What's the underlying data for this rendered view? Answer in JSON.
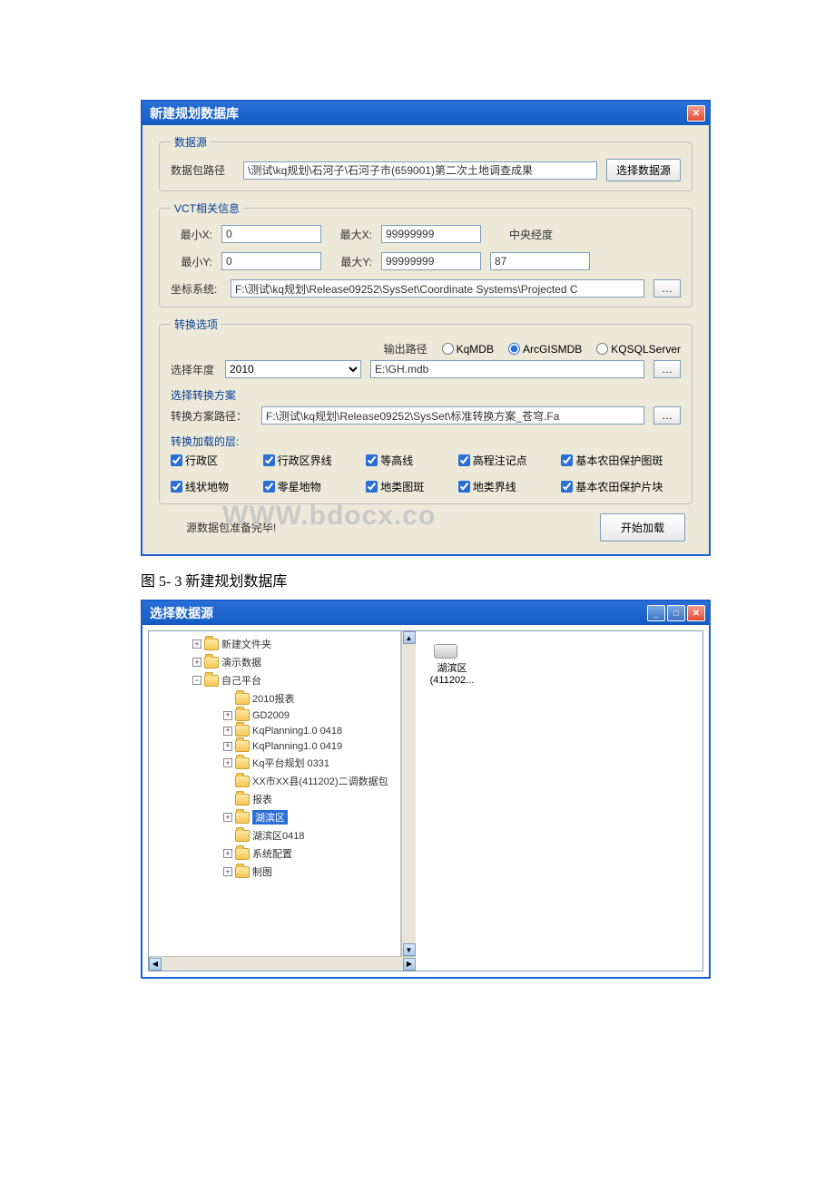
{
  "dialog1": {
    "title": "新建规划数据库",
    "source": {
      "legend": "数据源",
      "path_label": "数据包路径",
      "path_value": "\\测试\\kq规划\\石河子\\石河子市(659001)第二次土地调查成果",
      "select_btn": "选择数据源"
    },
    "vct": {
      "legend": "VCT相关信息",
      "minx_label": "最小X:",
      "minx": "0",
      "maxx_label": "最大X:",
      "maxx": "99999999",
      "central_label": "中央经度",
      "miny_label": "最小Y:",
      "miny": "0",
      "maxy_label": "最大Y:",
      "maxy": "99999999",
      "central_value": "87",
      "coord_label": "坐标系统:",
      "coord_value": "F:\\测试\\kq规划\\Release09252\\SysSet\\Coordinate Systems\\Projected C"
    },
    "convert": {
      "legend": "转换选项",
      "output_path_label": "输出路径",
      "radio1": "KqMDB",
      "radio2": "ArcGISMDB",
      "radio3": "KQSQLServer",
      "year_label": "选择年度",
      "year": "2010",
      "output_value": "E:\\GH.mdb",
      "scheme_legend": "选择转换方案",
      "scheme_label": "转换方案路径：",
      "scheme_value": "F:\\测试\\kq规划\\Release09252\\SysSet\\标准转换方案_苍穹.Fa",
      "layers_legend": "转换加载的层:",
      "layers": [
        "行政区",
        "行政区界线",
        "等高线",
        "高程注记点",
        "基本农田保护图斑",
        "线状地物",
        "零星地物",
        "地类图斑",
        "地类界线",
        "基本农田保护片块"
      ]
    },
    "status": "源数据包准备完毕!",
    "start_btn": "开始加载",
    "watermark": "WWW.bdocx.co"
  },
  "caption": "图 5- 3 新建规划数据库",
  "dialog2": {
    "title": "选择数据源",
    "tree": {
      "n0": {
        "exp": "+",
        "label": "新建文件夹"
      },
      "n1": {
        "exp": "+",
        "label": "演示数据"
      },
      "n2": {
        "exp": "−",
        "label": "自己平台"
      },
      "c0": {
        "exp": "",
        "label": "2010报表"
      },
      "c1": {
        "exp": "+",
        "label": "GD2009"
      },
      "c2": {
        "exp": "+",
        "label": "KqPlanning1.0 0418"
      },
      "c3": {
        "exp": "+",
        "label": "KqPlanning1.0 0419"
      },
      "c4": {
        "exp": "+",
        "label": "Kq平台规划 0331"
      },
      "c5": {
        "exp": "",
        "label": "XX市XX县(411202)二调数据包"
      },
      "c6": {
        "exp": "",
        "label": "报表"
      },
      "c7": {
        "exp": "+",
        "label": "湖滨区"
      },
      "c8": {
        "exp": "",
        "label": "湖滨区0418"
      },
      "c9": {
        "exp": "+",
        "label": "系统配置"
      },
      "c10": {
        "exp": "+",
        "label": "制图"
      }
    },
    "detail_label": "湖滨区\n(411202..."
  }
}
